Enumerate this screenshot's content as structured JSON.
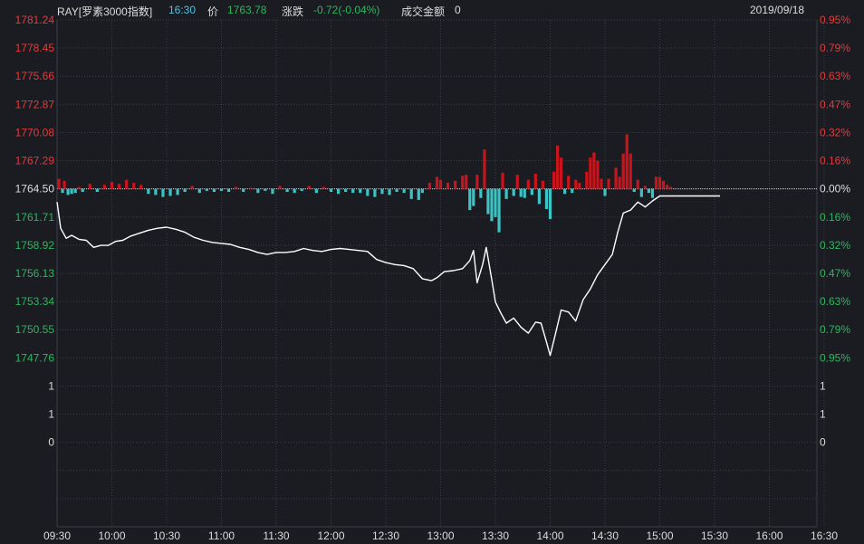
{
  "header": {
    "code": "RAY[罗素3000指数]",
    "time": "16:30",
    "price_label": "价",
    "price": "1763.78",
    "change_label": "涨跌",
    "change": "-0.72(-0.04%)",
    "amount_label": "成交金额",
    "amount": "0",
    "date": "2019/09/18"
  },
  "colors": {
    "background": "#1b1c22",
    "grid": "#3a3d4a",
    "up": "#c8141a",
    "down": "#3cc4c4",
    "line": "#ffffff",
    "label_red": "#e23b3b",
    "label_green": "#2fb55f",
    "label_white": "#dcdcdc",
    "time_cyan": "#4dc3e0"
  },
  "chart_data": {
    "type": "line",
    "base": 1764.5,
    "x_ticks": [
      "09:30",
      "10:00",
      "10:30",
      "11:00",
      "11:30",
      "12:00",
      "12:30",
      "13:00",
      "13:30",
      "14:00",
      "14:30",
      "15:00",
      "15:30",
      "16:00",
      "16:30"
    ],
    "y_left_ticks": [
      "1781.24",
      "1778.45",
      "1775.66",
      "1772.87",
      "1770.08",
      "1767.29",
      "1764.50",
      "1761.71",
      "1758.92",
      "1756.13",
      "1753.34",
      "1750.55",
      "1747.76",
      "1",
      "1",
      "0"
    ],
    "y_right_ticks": [
      "0.95%",
      "0.79%",
      "0.63%",
      "0.47%",
      "0.32%",
      "0.16%",
      "0.00%",
      "0.16%",
      "0.32%",
      "0.47%",
      "0.63%",
      "0.79%",
      "0.95%",
      "1",
      "1",
      "0"
    ],
    "price_series": [
      [
        0,
        1763.2
      ],
      [
        2,
        1760.6
      ],
      [
        5,
        1759.6
      ],
      [
        8,
        1759.9
      ],
      [
        12,
        1759.5
      ],
      [
        16,
        1759.4
      ],
      [
        20,
        1758.7
      ],
      [
        24,
        1758.9
      ],
      [
        28,
        1758.9
      ],
      [
        32,
        1759.3
      ],
      [
        36,
        1759.4
      ],
      [
        40,
        1759.8
      ],
      [
        45,
        1760.1
      ],
      [
        50,
        1760.4
      ],
      [
        55,
        1760.6
      ],
      [
        60,
        1760.7
      ],
      [
        65,
        1760.5
      ],
      [
        70,
        1760.2
      ],
      [
        75,
        1759.7
      ],
      [
        80,
        1759.4
      ],
      [
        85,
        1759.2
      ],
      [
        90,
        1759.1
      ],
      [
        95,
        1759.0
      ],
      [
        100,
        1758.7
      ],
      [
        105,
        1758.5
      ],
      [
        110,
        1758.2
      ],
      [
        115,
        1758.0
      ],
      [
        120,
        1758.2
      ],
      [
        125,
        1758.2
      ],
      [
        130,
        1758.3
      ],
      [
        135,
        1758.6
      ],
      [
        140,
        1758.4
      ],
      [
        145,
        1758.3
      ],
      [
        150,
        1758.5
      ],
      [
        155,
        1758.6
      ],
      [
        160,
        1758.5
      ],
      [
        165,
        1758.4
      ],
      [
        170,
        1758.3
      ],
      [
        175,
        1757.5
      ],
      [
        180,
        1757.2
      ],
      [
        185,
        1757.0
      ],
      [
        190,
        1756.9
      ],
      [
        195,
        1756.6
      ],
      [
        200,
        1755.6
      ],
      [
        205,
        1755.4
      ],
      [
        208,
        1755.7
      ],
      [
        212,
        1756.3
      ],
      [
        217,
        1756.4
      ],
      [
        222,
        1756.6
      ],
      [
        226,
        1757.4
      ],
      [
        228,
        1758.4
      ],
      [
        230,
        1755.2
      ],
      [
        233,
        1757.0
      ],
      [
        235,
        1758.7
      ],
      [
        238,
        1755.5
      ],
      [
        240,
        1753.3
      ],
      [
        243,
        1752.2
      ],
      [
        246,
        1751.2
      ],
      [
        250,
        1751.7
      ],
      [
        254,
        1750.8
      ],
      [
        258,
        1750.2
      ],
      [
        262,
        1751.3
      ],
      [
        265,
        1751.2
      ],
      [
        268,
        1749.3
      ],
      [
        270,
        1748.0
      ],
      [
        273,
        1750.2
      ],
      [
        276,
        1752.5
      ],
      [
        280,
        1752.3
      ],
      [
        284,
        1751.4
      ],
      [
        288,
        1753.5
      ],
      [
        292,
        1754.6
      ],
      [
        296,
        1756.0
      ],
      [
        300,
        1757.0
      ],
      [
        304,
        1758.0
      ],
      [
        307,
        1760.2
      ],
      [
        310,
        1762.1
      ],
      [
        314,
        1762.4
      ],
      [
        318,
        1763.2
      ],
      [
        322,
        1762.7
      ],
      [
        326,
        1763.3
      ],
      [
        330,
        1763.8
      ],
      [
        345,
        1763.8
      ],
      [
        363,
        1763.8
      ]
    ],
    "bars": [
      [
        1,
        1.0
      ],
      [
        3,
        -0.4
      ],
      [
        4,
        0.8
      ],
      [
        6,
        -0.6
      ],
      [
        8,
        -0.5
      ],
      [
        10,
        -0.4
      ],
      [
        12,
        0.2
      ],
      [
        14,
        -0.3
      ],
      [
        18,
        0.5
      ],
      [
        22,
        -0.3
      ],
      [
        26,
        0.4
      ],
      [
        30,
        0.7
      ],
      [
        34,
        0.5
      ],
      [
        38,
        0.9
      ],
      [
        42,
        0.6
      ],
      [
        46,
        0.4
      ],
      [
        50,
        -0.5
      ],
      [
        54,
        -0.6
      ],
      [
        58,
        -0.8
      ],
      [
        62,
        -0.7
      ],
      [
        66,
        -0.6
      ],
      [
        70,
        -0.3
      ],
      [
        74,
        0.3
      ],
      [
        78,
        -0.4
      ],
      [
        82,
        -0.2
      ],
      [
        86,
        -0.3
      ],
      [
        90,
        -0.2
      ],
      [
        94,
        -0.3
      ],
      [
        98,
        0.2
      ],
      [
        102,
        -0.3
      ],
      [
        106,
        0.1
      ],
      [
        110,
        -0.4
      ],
      [
        114,
        -0.2
      ],
      [
        118,
        -0.5
      ],
      [
        122,
        0.3
      ],
      [
        126,
        -0.3
      ],
      [
        130,
        -0.4
      ],
      [
        134,
        -0.2
      ],
      [
        138,
        0.3
      ],
      [
        142,
        -0.4
      ],
      [
        146,
        0.2
      ],
      [
        150,
        -0.3
      ],
      [
        154,
        -0.5
      ],
      [
        158,
        -0.3
      ],
      [
        162,
        -0.4
      ],
      [
        166,
        -0.4
      ],
      [
        170,
        -0.7
      ],
      [
        174,
        -0.8
      ],
      [
        178,
        -0.5
      ],
      [
        182,
        -0.6
      ],
      [
        186,
        -0.3
      ],
      [
        190,
        -0.4
      ],
      [
        194,
        -1.0
      ],
      [
        198,
        -1.1
      ],
      [
        200,
        -0.4
      ],
      [
        204,
        0.6
      ],
      [
        208,
        1.2
      ],
      [
        210,
        0.9
      ],
      [
        214,
        0.6
      ],
      [
        218,
        0.8
      ],
      [
        222,
        1.3
      ],
      [
        224,
        1.4
      ],
      [
        226,
        -2.1
      ],
      [
        228,
        -1.7
      ],
      [
        230,
        1.4
      ],
      [
        232,
        -0.9
      ],
      [
        234,
        3.9
      ],
      [
        236,
        -2.5
      ],
      [
        238,
        -3.2
      ],
      [
        240,
        -2.8
      ],
      [
        242,
        -4.3
      ],
      [
        244,
        1.6
      ],
      [
        246,
        -1.0
      ],
      [
        250,
        -0.7
      ],
      [
        252,
        1.4
      ],
      [
        254,
        -0.8
      ],
      [
        256,
        -0.9
      ],
      [
        258,
        0.9
      ],
      [
        260,
        -0.6
      ],
      [
        262,
        1.5
      ],
      [
        264,
        -1.5
      ],
      [
        266,
        0.8
      ],
      [
        268,
        -2.0
      ],
      [
        270,
        -3.0
      ],
      [
        272,
        1.7
      ],
      [
        274,
        4.3
      ],
      [
        276,
        3.1
      ],
      [
        278,
        -0.5
      ],
      [
        280,
        1.3
      ],
      [
        282,
        -0.4
      ],
      [
        284,
        0.9
      ],
      [
        286,
        0.6
      ],
      [
        290,
        1.7
      ],
      [
        292,
        3.1
      ],
      [
        294,
        3.6
      ],
      [
        296,
        2.8
      ],
      [
        298,
        1.0
      ],
      [
        300,
        -0.7
      ],
      [
        302,
        1.0
      ],
      [
        306,
        2.1
      ],
      [
        308,
        1.2
      ],
      [
        310,
        3.5
      ],
      [
        312,
        5.4
      ],
      [
        314,
        3.5
      ],
      [
        316,
        -0.3
      ],
      [
        318,
        0.9
      ],
      [
        320,
        -0.8
      ],
      [
        322,
        0.3
      ],
      [
        324,
        -0.4
      ],
      [
        326,
        -0.9
      ],
      [
        328,
        1.2
      ],
      [
        330,
        1.2
      ],
      [
        332,
        0.8
      ],
      [
        334,
        0.4
      ],
      [
        336,
        0.2
      ]
    ]
  }
}
